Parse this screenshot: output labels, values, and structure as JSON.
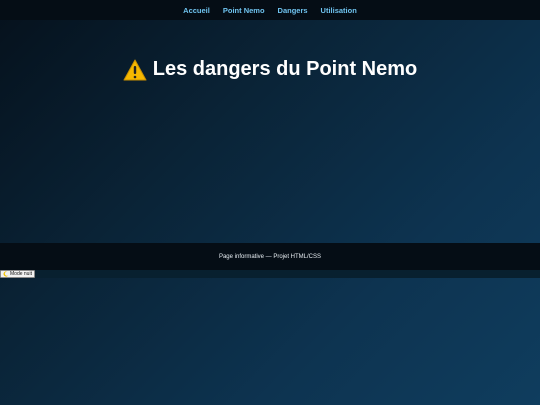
{
  "nav": {
    "items": [
      {
        "label": "Accueil"
      },
      {
        "label": "Point Nemo"
      },
      {
        "label": "Dangers"
      },
      {
        "label": "Utilisation"
      }
    ]
  },
  "hero": {
    "icon": "warning-icon",
    "title": "Les dangers du Point Nemo"
  },
  "footer": {
    "text": "Page informative — Projet HTML/CSS"
  },
  "mode_toggle": {
    "icon": "moon-icon",
    "label": "Mode nuit"
  },
  "colors": {
    "nav_link": "#6fc3ef",
    "bar_bg": "#050d15",
    "warning": "#f5b800"
  }
}
